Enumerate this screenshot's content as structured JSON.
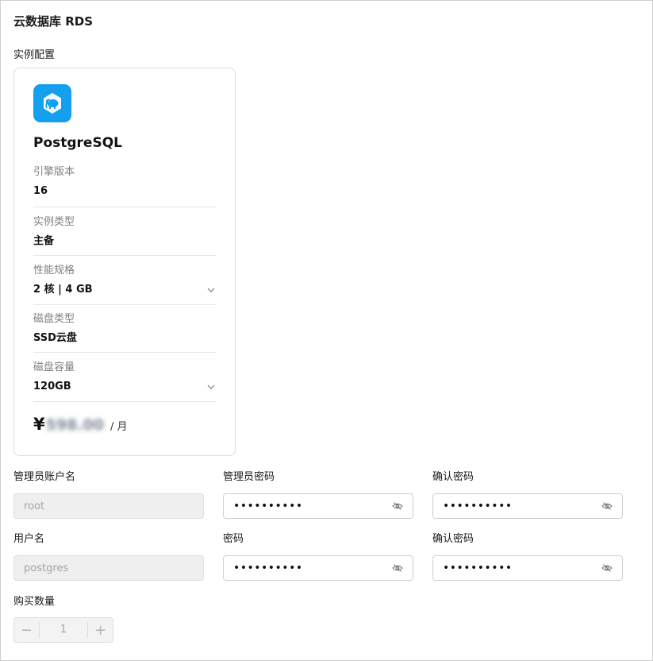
{
  "page": {
    "title": "云数据库 RDS"
  },
  "instance_config": {
    "section_title": "实例配置",
    "engine": {
      "name": "PostgreSQL",
      "logo_icon": "postgresql-elephant-icon",
      "logo_color": "#14a0ee"
    },
    "fields": [
      {
        "label": "引擎版本",
        "value": "16",
        "has_dropdown": false
      },
      {
        "label": "实例类型",
        "value": "主备",
        "has_dropdown": false
      },
      {
        "label": "性能规格",
        "value": "2 核 | 4 GB",
        "has_dropdown": true
      },
      {
        "label": "磁盘类型",
        "value": "SSD云盘",
        "has_dropdown": false
      },
      {
        "label": "磁盘容量",
        "value": "120GB",
        "has_dropdown": true
      }
    ],
    "price": {
      "currency": "¥",
      "amount": "598.00",
      "unit": "/ 月",
      "blurred": true
    }
  },
  "credentials": {
    "admin_username_label": "管理员账户名",
    "admin_username_value": "root",
    "admin_password_label": "管理员密码",
    "admin_password_value": "••••••••••",
    "admin_confirm_label": "确认密码",
    "admin_confirm_value": "••••••••••",
    "username_label": "用户名",
    "username_value": "postgres",
    "password_label": "密码",
    "password_value": "••••••••••",
    "confirm_label": "确认密码",
    "confirm_value": "••••••••••"
  },
  "purchase": {
    "label": "购买数量",
    "quantity": "1",
    "minus": "−",
    "plus": "+"
  }
}
